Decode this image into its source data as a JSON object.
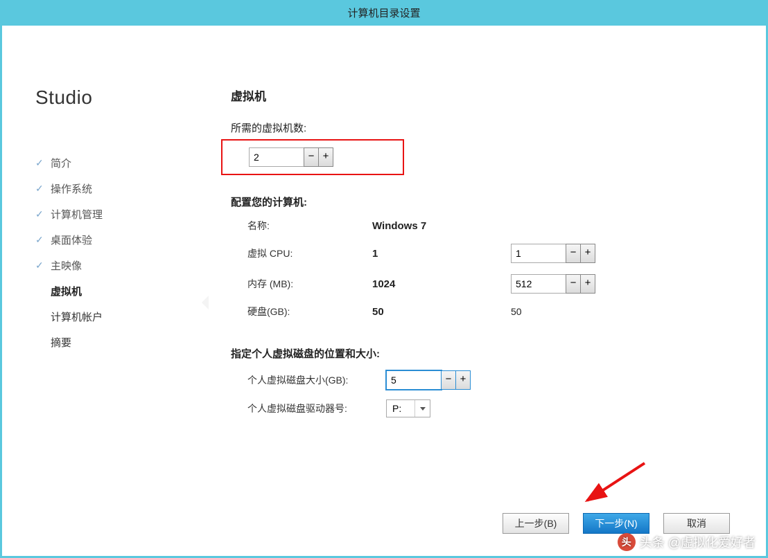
{
  "window": {
    "title": "计算机目录设置"
  },
  "brand": "Studio",
  "nav": {
    "items": [
      {
        "label": "简介",
        "state": "done"
      },
      {
        "label": "操作系统",
        "state": "done"
      },
      {
        "label": "计算机管理",
        "state": "done"
      },
      {
        "label": "桌面体验",
        "state": "done"
      },
      {
        "label": "主映像",
        "state": "done"
      },
      {
        "label": "虚拟机",
        "state": "current"
      },
      {
        "label": "计算机帐户",
        "state": "future"
      },
      {
        "label": "摘要",
        "state": "future"
      }
    ]
  },
  "main": {
    "heading": "虚拟机",
    "vm_count": {
      "label": "所需的虚拟机数:",
      "value": "2"
    },
    "config_title": "配置您的计算机:",
    "rows": {
      "name": {
        "label": "名称:",
        "value": "Windows 7"
      },
      "cpu": {
        "label": "虚拟 CPU:",
        "value": "1",
        "stepper": "1"
      },
      "memory": {
        "label": "内存 (MB):",
        "value": "1024",
        "stepper": "512"
      },
      "disk": {
        "label": "硬盘(GB):",
        "value": "50",
        "right": "50"
      }
    },
    "personal_disk": {
      "title": "指定个人虚拟磁盘的位置和大小:",
      "size": {
        "label": "个人虚拟磁盘大小(GB):",
        "value": "5"
      },
      "drive": {
        "label": "个人虚拟磁盘驱动器号:",
        "value": "P:"
      }
    }
  },
  "buttons": {
    "back": "上一步(B)",
    "next": "下一步(N)",
    "cancel": "取消"
  },
  "watermark": {
    "text": "头条 @虚拟化爱好者"
  }
}
